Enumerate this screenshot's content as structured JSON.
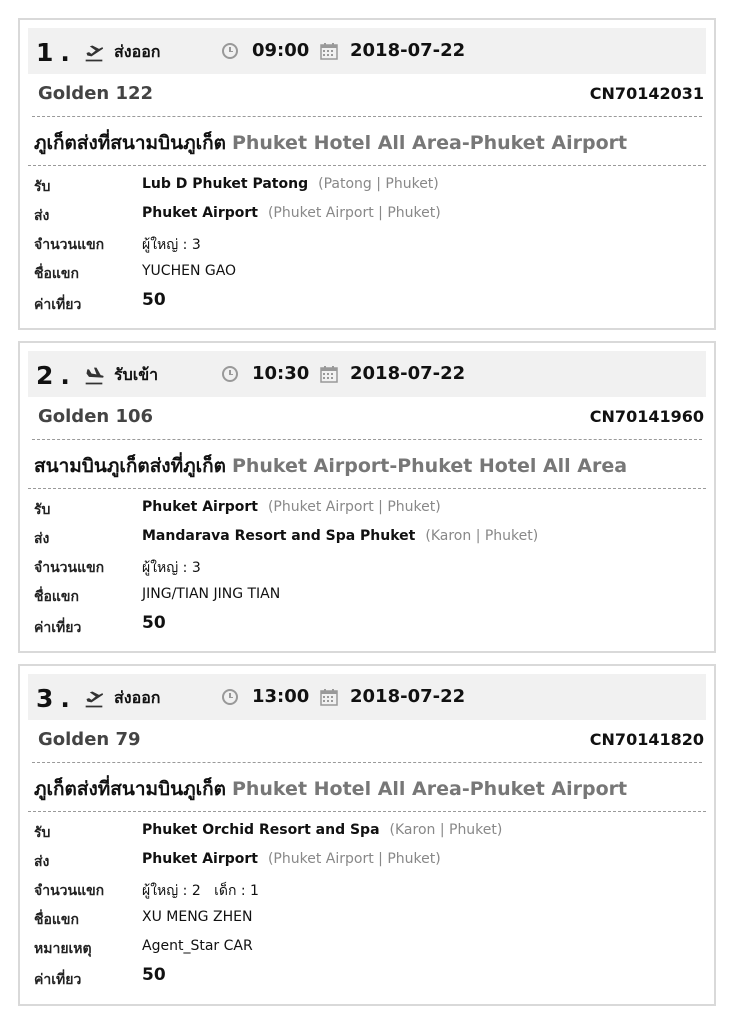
{
  "bookings": [
    {
      "num": "1",
      "dot": ".",
      "trip_type": "ส่งออก",
      "plane_icon": "plane-departure-icon",
      "time": "09:00",
      "date": "2018-07-22",
      "car": "Golden 122",
      "code": "CN70142031",
      "route_th": "ภูเก็ตส่งที่สนามบินภูเก็ต",
      "route_en": "Phuket Hotel All Area-Phuket Airport",
      "pickup_label": "รับ",
      "pickup_name": "Lub D Phuket Patong",
      "pickup_loc": "(Patong | Phuket)",
      "drop_label": "ส่ง",
      "drop_name": "Phuket Airport",
      "drop_loc": "(Phuket Airport | Phuket)",
      "pax_label": "จำนวนแขก",
      "pax": "ผู้ใหญ่ : 3",
      "guest_label": "ชื่อแขก",
      "guest": "YUCHEN GAO",
      "fare_label": "ค่าเที่ยว",
      "fare": "50"
    },
    {
      "num": "2",
      "dot": ".",
      "trip_type": "รับเข้า",
      "plane_icon": "plane-arrival-icon",
      "time": "10:30",
      "date": "2018-07-22",
      "car": "Golden 106",
      "code": "CN70141960",
      "route_th": "สนามบินภูเก็ตส่งที่ภูเก็ต",
      "route_en": "Phuket Airport-Phuket Hotel All Area",
      "pickup_label": "รับ",
      "pickup_name": "Phuket Airport",
      "pickup_loc": "(Phuket Airport | Phuket)",
      "drop_label": "ส่ง",
      "drop_name": "Mandarava Resort and Spa Phuket",
      "drop_loc": "(Karon | Phuket)",
      "pax_label": "จำนวนแขก",
      "pax": "ผู้ใหญ่ : 3",
      "guest_label": "ชื่อแขก",
      "guest": "JING/TIAN JING TIAN",
      "fare_label": "ค่าเที่ยว",
      "fare": "50"
    },
    {
      "num": "3",
      "dot": ".",
      "trip_type": "ส่งออก",
      "plane_icon": "plane-departure-icon",
      "time": "13:00",
      "date": "2018-07-22",
      "car": "Golden 79",
      "code": "CN70141820",
      "route_th": "ภูเก็ตส่งที่สนามบินภูเก็ต",
      "route_en": "Phuket Hotel All Area-Phuket Airport",
      "pickup_label": "รับ",
      "pickup_name": "Phuket Orchid Resort and Spa",
      "pickup_loc": "(Karon | Phuket)",
      "drop_label": "ส่ง",
      "drop_name": "Phuket Airport",
      "drop_loc": "(Phuket Airport | Phuket)",
      "pax_label": "จำนวนแขก",
      "pax": "ผู้ใหญ่ : 2   เด็ก : 1",
      "guest_label": "ชื่อแขก",
      "guest": "XU MENG ZHEN",
      "note_label": "หมายเหตุ",
      "note": "Agent_Star CAR",
      "fare_label": "ค่าเที่ยว",
      "fare": "50"
    }
  ]
}
